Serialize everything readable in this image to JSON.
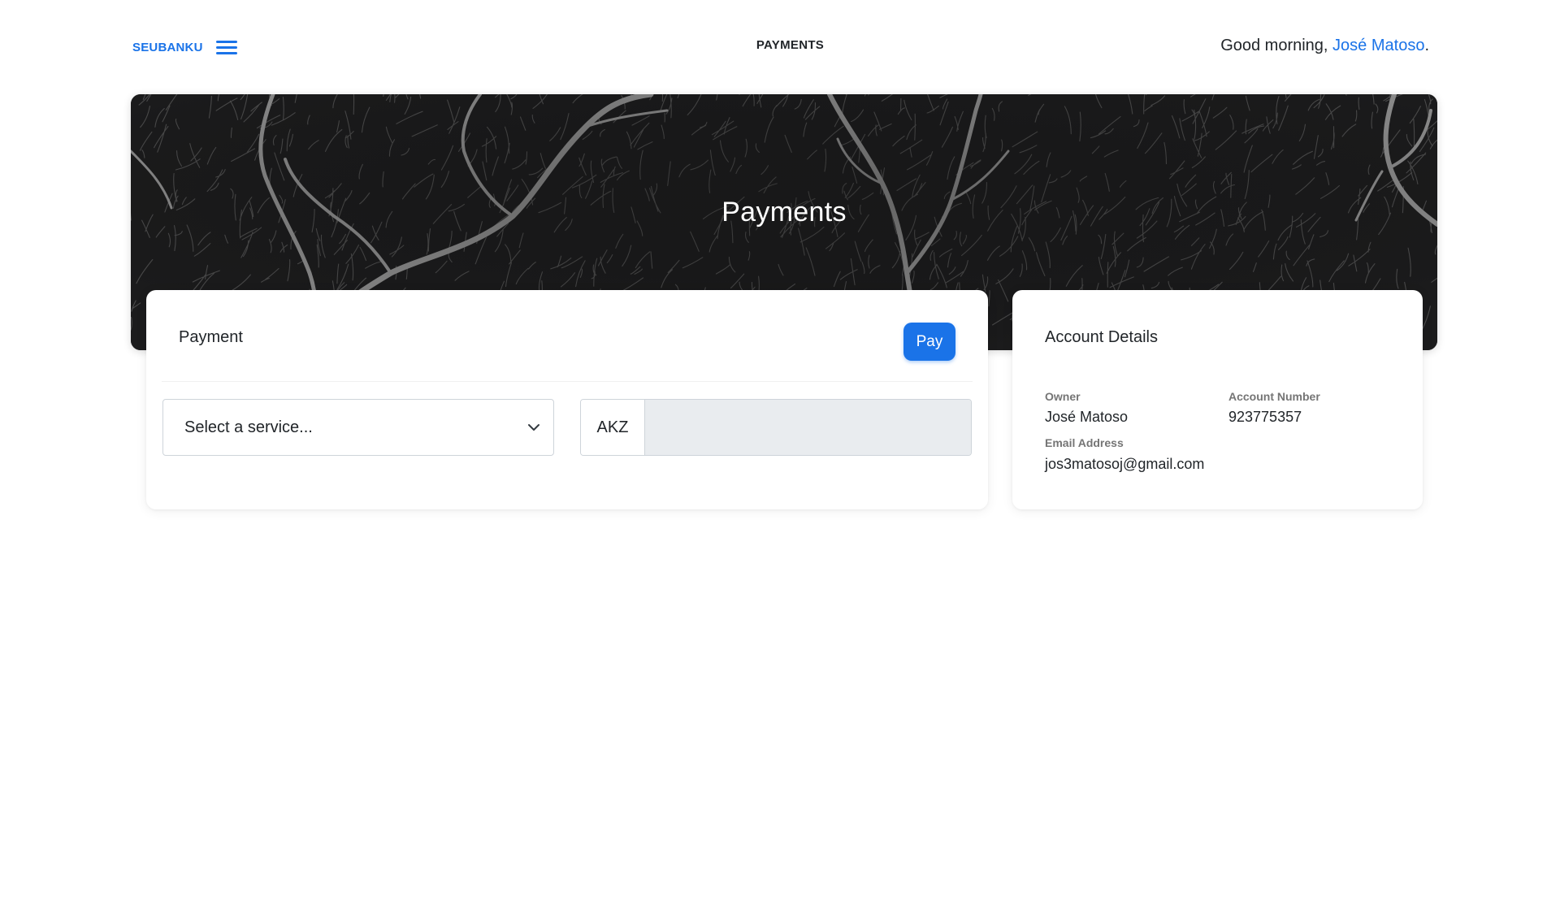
{
  "topnav": {
    "brand": "SEUBANKU",
    "menu_icon": "hamburger-menu-icon",
    "title": "PAYMENTS",
    "greeting_prefix": "Good morning, ",
    "user_name": "José Matoso",
    "greeting_suffix": "."
  },
  "hero": {
    "title": "Payments"
  },
  "payment_card": {
    "title": "Payment",
    "pay_label": "Pay",
    "service_select": {
      "selected": "Select a service...",
      "icon": "chevron-down-icon"
    },
    "amount": {
      "currency": "AKZ",
      "value": ""
    }
  },
  "account_card": {
    "title": "Account Details",
    "owner_label": "Owner",
    "owner_value": "José Matoso",
    "account_number_label": "Account Number",
    "account_number_value": "923775357",
    "email_label": "Email Address",
    "email_value": "jos3matosoj@gmail.com"
  },
  "colors": {
    "accent": "#1a73e8",
    "hero_background": "#1b1b1b",
    "input_disabled": "#e9ecef"
  }
}
